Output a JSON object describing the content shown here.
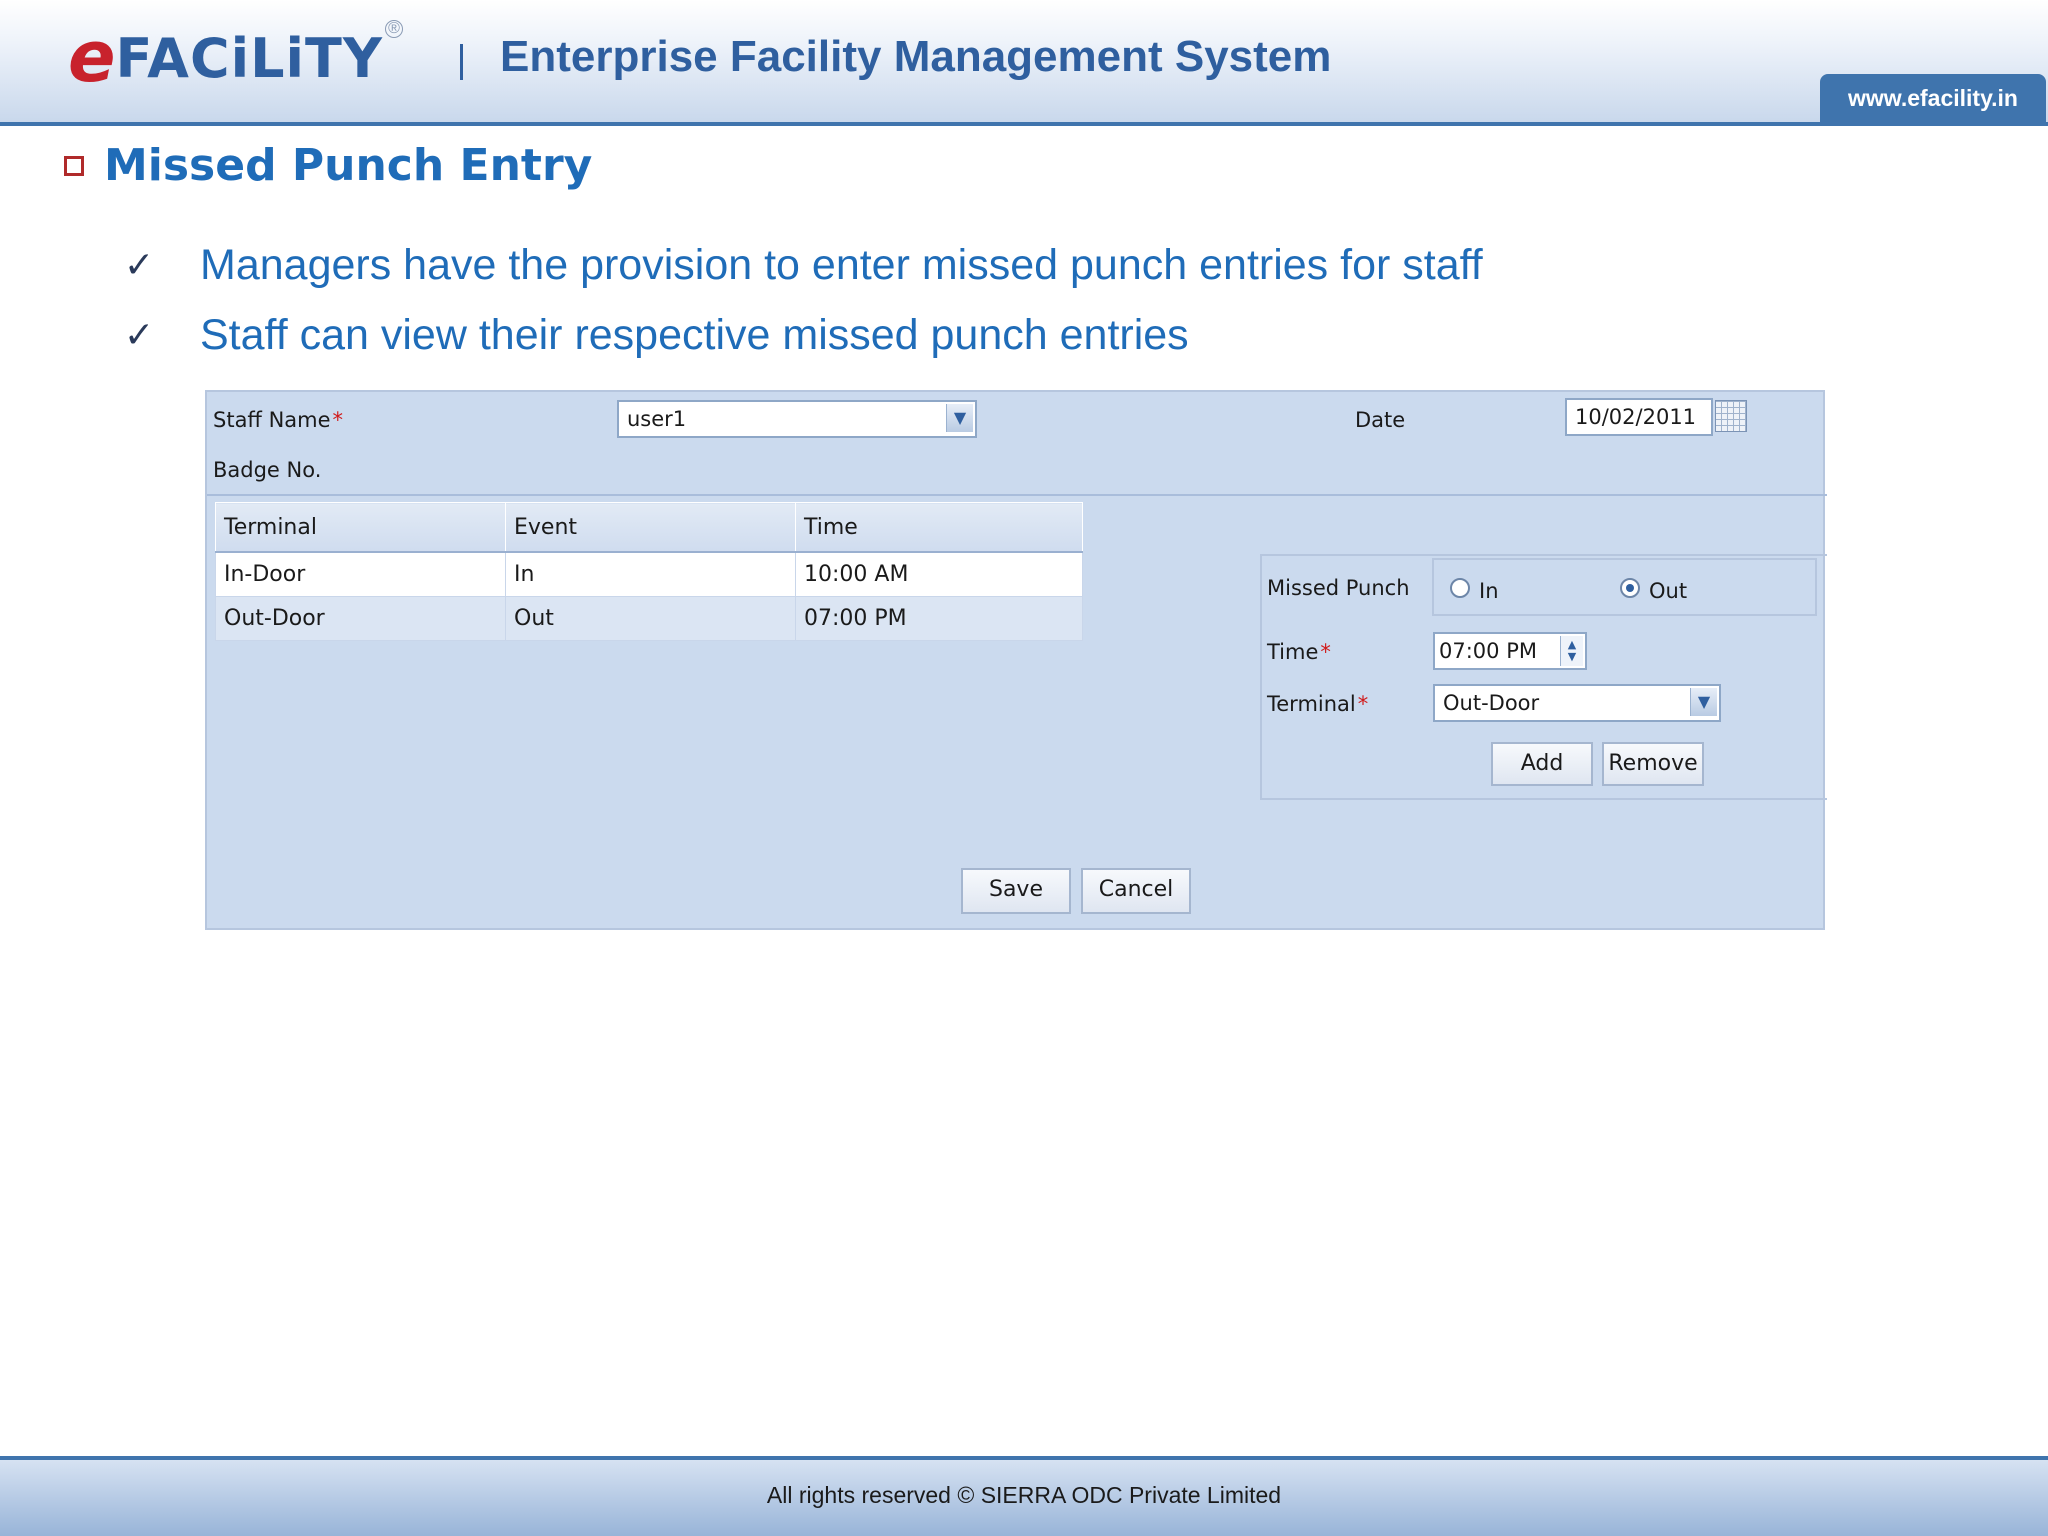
{
  "header": {
    "logo_e": "e",
    "logo_main": "FACiLiTY",
    "logo_reg": "®",
    "system_title": "Enterprise Facility Management System",
    "website": "www.efacility.in"
  },
  "slide": {
    "heading": "Missed Punch Entry",
    "bullets": [
      "Managers have the provision to enter missed punch entries for staff",
      "Staff can view their respective missed punch entries"
    ],
    "check_glyph": "✓"
  },
  "form": {
    "staff_name_label": "Staff Name",
    "required_mark": "*",
    "staff_name_value": "user1",
    "date_label": "Date",
    "date_value": "10/02/2011",
    "badge_label": "Badge No.",
    "table": {
      "headers": [
        "Terminal",
        "Event",
        "Time"
      ],
      "rows": [
        [
          "In-Door",
          "In",
          "10:00 AM"
        ],
        [
          "Out-Door",
          "Out",
          "07:00 PM"
        ]
      ]
    },
    "missed_punch_label": "Missed Punch",
    "radio_in_label": "In",
    "radio_out_label": "Out",
    "selected_punch": "Out",
    "time_label": "Time",
    "time_value": "07:00 PM",
    "terminal_label": "Terminal",
    "terminal_value": "Out-Door",
    "add_label": "Add",
    "remove_label": "Remove",
    "save_label": "Save",
    "cancel_label": "Cancel"
  },
  "footer": {
    "text": "All rights reserved © SIERRA ODC Private Limited"
  },
  "colors": {
    "brand_blue": "#2f5f9f",
    "brand_red": "#c8222c",
    "text_blue": "#1f6cb8",
    "panel_bg": "#cbdaee"
  }
}
